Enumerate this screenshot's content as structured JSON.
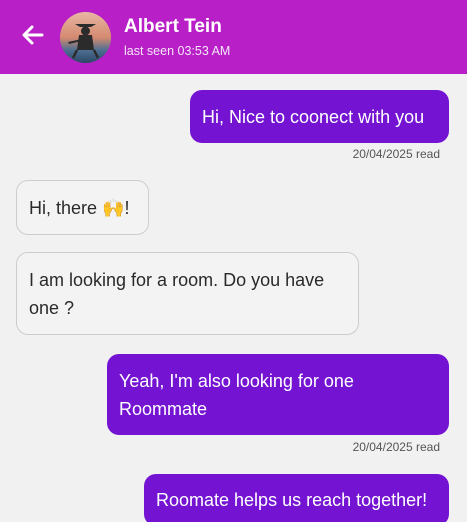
{
  "header": {
    "contact_name": "Albert Tein",
    "last_seen": "last seen 03:53 AM"
  },
  "messages": [
    {
      "direction": "out",
      "text": "Hi, Nice to coonect with you",
      "meta": "20/04/2025 read"
    },
    {
      "direction": "in",
      "text": "Hi, there 🙌!"
    },
    {
      "direction": "in",
      "text": "I am looking for a room. Do you have one ?"
    },
    {
      "direction": "out",
      "text": "Yeah, I'm also looking for one Roommate",
      "meta": "20/04/2025 read"
    },
    {
      "direction": "out",
      "text": "Roomate helps us reach together!"
    }
  ],
  "colors": {
    "header_bg": "#b81fc7",
    "outgoing_bubble": "#7413d2",
    "incoming_bubble": "#f3f3f3",
    "background": "#f1f1f1"
  },
  "icons": {
    "back": "arrow-left-icon"
  }
}
